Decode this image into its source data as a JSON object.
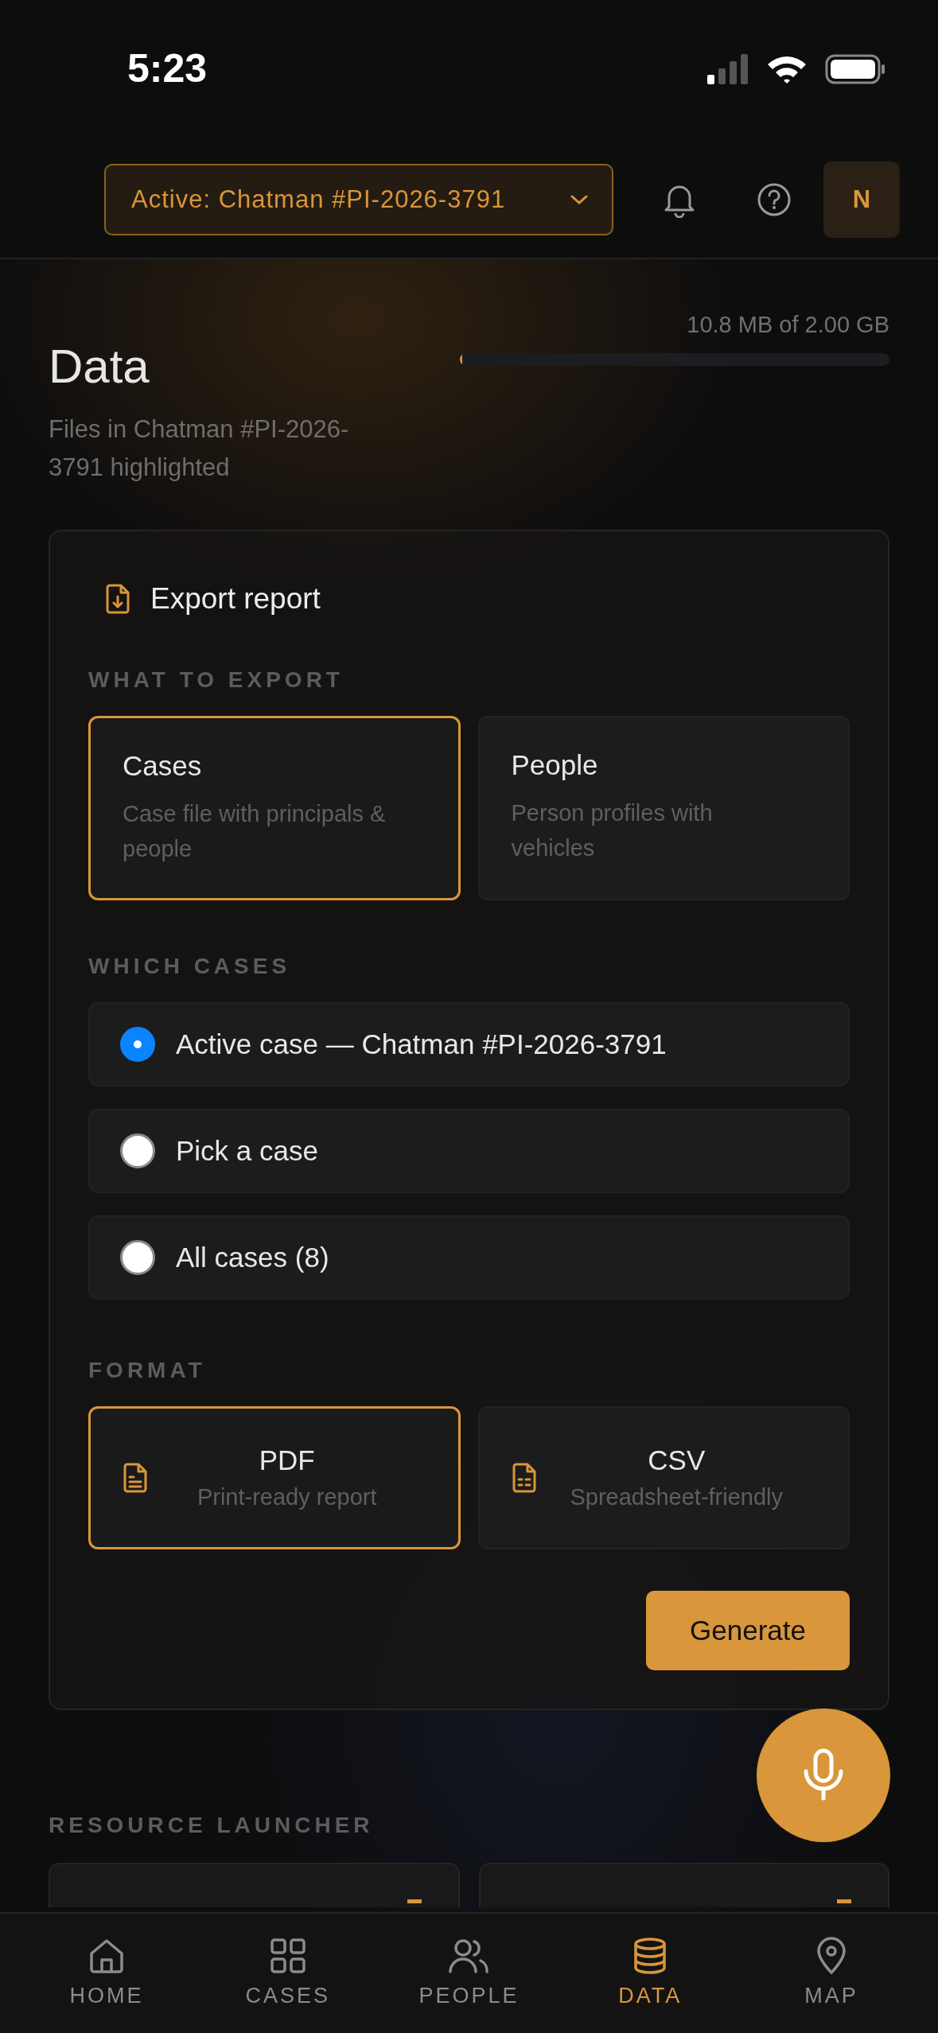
{
  "status_bar": {
    "time": "5:23"
  },
  "top_bar": {
    "case_selector": {
      "label": "Active: Chatman #PI-2026-3791"
    },
    "avatar": {
      "initial": "N"
    }
  },
  "header": {
    "title": "Data",
    "subtitle": "Files in Chatman #PI-2026-3791 highlighted",
    "storage": {
      "reading": "10.8 MB of 2.00 GB",
      "level": 0.006
    }
  },
  "export_card": {
    "title": "Export report",
    "what_to_export": {
      "heading": "WHAT TO EXPORT",
      "options": [
        {
          "title": "Cases",
          "description": "Case file with principals & people",
          "selected": true
        },
        {
          "title": "People",
          "description": "Person profiles with vehicles",
          "selected": false
        }
      ]
    },
    "which_cases": {
      "heading": "WHICH CASES",
      "options": [
        {
          "label": "Active case — Chatman #PI-2026-3791",
          "selected": true
        },
        {
          "label": "Pick a case",
          "selected": false
        },
        {
          "label": "All cases (8)",
          "selected": false
        }
      ]
    },
    "format": {
      "heading": "FORMAT",
      "options": [
        {
          "kind": "document",
          "title": "PDF",
          "description": "Print-ready report",
          "selected": true
        },
        {
          "kind": "spreadsheet",
          "title": "CSV",
          "description": "Spreadsheet-friendly",
          "selected": false
        }
      ]
    },
    "action_button": "Generate"
  },
  "resource_launcher": {
    "heading": "RESOURCE LAUNCHER"
  },
  "bottom_nav": [
    {
      "kind": "home",
      "label": "HOME",
      "selected": false
    },
    {
      "kind": "grid",
      "label": "CASES",
      "selected": false
    },
    {
      "kind": "people",
      "label": "PEOPLE",
      "selected": false
    },
    {
      "kind": "data",
      "label": "DATA",
      "selected": true
    },
    {
      "kind": "map",
      "label": "MAP",
      "selected": false
    }
  ]
}
